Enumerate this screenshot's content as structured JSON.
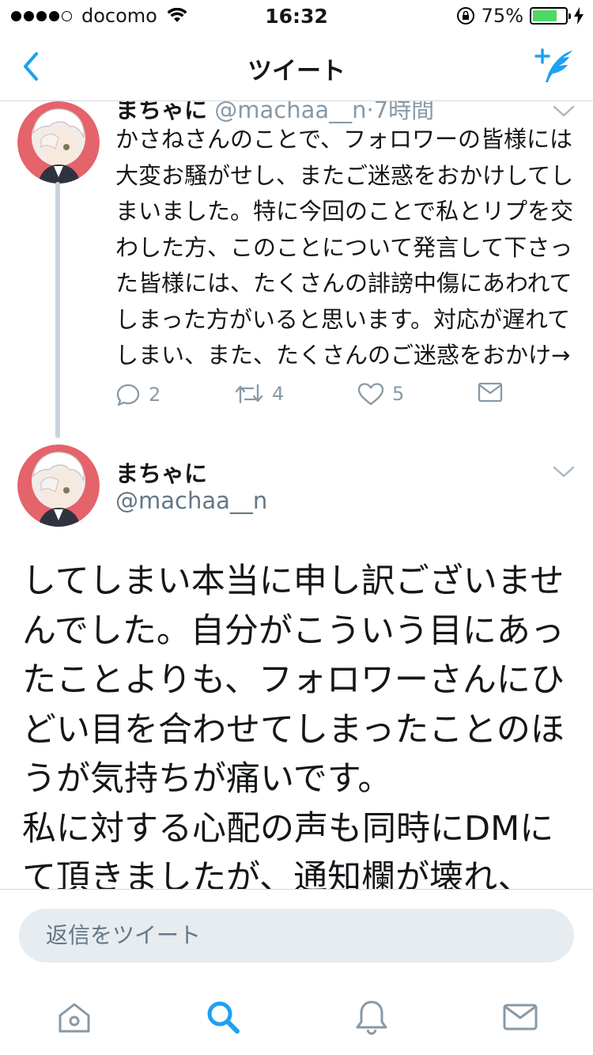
{
  "status_bar": {
    "carrier": "docomo",
    "time": "16:32",
    "battery_percent": "75%",
    "battery_level": 0.75
  },
  "nav": {
    "title": "ツイート",
    "back_icon": "chevron-left-icon",
    "compose_icon": "compose-tweet-icon"
  },
  "tweet_parent": {
    "name": "まちゃに",
    "handle": "@machaa__n",
    "time_ago": "·7時間",
    "body": "かさねさんのことで、フォロワーの皆様には大変お騒がせし、またご迷惑をおかけしてしまいました。特に今回のことで私とリプを交わした方、このことについて発言して下さった皆様には、たくさんの誹謗中傷にあわれてしまった方がいると思います。対応が遅れてしまい、また、たくさんのご迷惑をおかけ→",
    "replies": "2",
    "retweets": "4",
    "likes": "5"
  },
  "tweet_main": {
    "name": "まちゃに",
    "handle": "@machaa__n",
    "body": "してしまい本当に申し訳ございませんでした。自分がこういう目にあったことよりも、フォロワーさんにひどい目を合わせてしまったことのほうが気持ちが痛いです。\n私に対する心配の声も同時にDMにて頂きましたが、通知欄が壊れ、"
  },
  "reply": {
    "placeholder": "返信をツイート"
  },
  "tabs": [
    "home-icon",
    "search-icon",
    "notifications-icon",
    "messages-icon"
  ],
  "colors": {
    "accent": "#1da1f2",
    "muted": "#8899a6",
    "thread_line": "#c8d3dd",
    "reply_bg": "#e6ecf0",
    "battery": "#4cd964"
  }
}
